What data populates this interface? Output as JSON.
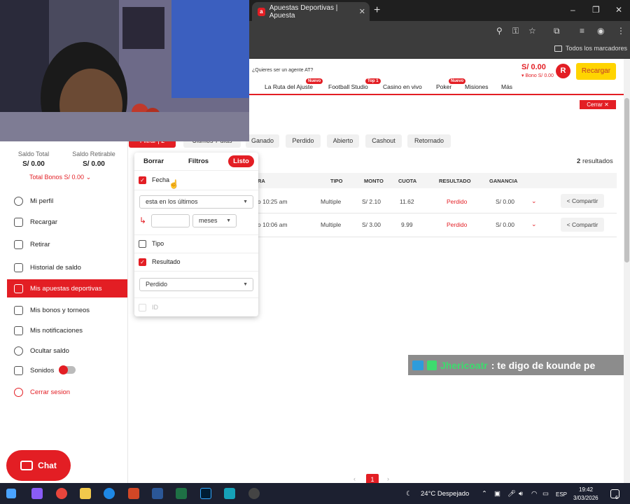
{
  "browser": {
    "tab_title": "Apuestas Deportivas | Apuesta",
    "tab_favicon": "a",
    "bookmarks_label": "Todos los marcadores"
  },
  "site": {
    "agent_link": "¿Quieres ser un agente AT?",
    "balance": "S/ 0.00",
    "bonus": "Bono S/ 0.00",
    "avatar_letter": "R",
    "recargar": "Recargar",
    "nav": [
      {
        "label": "La Ruta del Ajuste",
        "badge": "Nuevo"
      },
      {
        "label": "Football Studio",
        "badge": "Top 1"
      },
      {
        "label": "Casino en vivo",
        "badge": ""
      },
      {
        "label": "Poker",
        "badge": "Nuevo"
      },
      {
        "label": "Misiones",
        "badge": ""
      },
      {
        "label": "Más",
        "badge": ""
      }
    ],
    "cerrar": "Cerrar ✕"
  },
  "sidebar": {
    "saldo_total_label": "Saldo Total",
    "saldo_total": "S/ 0.00",
    "saldo_retirable_label": "Saldo Retirable",
    "saldo_retirable": "S/ 0.00",
    "total_bonos": "Total Bonos S/ 0.00",
    "menu": [
      {
        "label": "Mi perfil",
        "icon": "user-icon"
      },
      {
        "label": "Recargar",
        "icon": "refresh-icon"
      },
      {
        "label": "Retirar",
        "icon": "withdraw-icon"
      },
      {
        "label": "Historial de saldo",
        "icon": "history-icon"
      },
      {
        "label": "Mis apuestas deportivas",
        "icon": "ticket-icon",
        "active": true
      },
      {
        "label": "Mis bonos y torneos",
        "icon": "gift-icon"
      },
      {
        "label": "Mis notificaciones",
        "icon": "mail-icon"
      },
      {
        "label": "Ocultar saldo",
        "icon": "eye-off-icon"
      },
      {
        "label": "Sonidos",
        "icon": "speaker-icon"
      },
      {
        "label": "Cerrar sesion",
        "icon": "power-icon"
      }
    ],
    "chat": "Chat"
  },
  "filters": {
    "chip_filtrar": "Filtrar | 2",
    "chip_ultimos": "Últimos 7 días",
    "chips": [
      "Ganado",
      "Perdido",
      "Abierto",
      "Cashout",
      "Retornado"
    ],
    "results": "2",
    "results_label": "resultados"
  },
  "popup": {
    "borrar": "Borrar",
    "filtros": "Filtros",
    "listo": "Listo",
    "fecha": "Fecha",
    "fecha_select": "esta en los últimos",
    "unit_select": "meses",
    "tipo": "Tipo",
    "resultado": "Resultado",
    "resultado_select": "Perdido",
    "id": "ID"
  },
  "table": {
    "headers": [
      "RA",
      "TIPO",
      "MONTO",
      "CUOTA",
      "RESULTADO",
      "GANANCIA"
    ],
    "rows": [
      {
        "time": "o 10:25 am",
        "tipo": "Multiple",
        "monto": "S/ 2.10",
        "cuota": "11.62",
        "resultado": "Perdido",
        "ganancia": "S/ 0.00",
        "share": "Compartir"
      },
      {
        "time": "o 10:06 am",
        "tipo": "Multiple",
        "monto": "S/ 3.00",
        "cuota": "9.99",
        "resultado": "Perdido",
        "ganancia": "S/ 0.00",
        "share": "Compartir"
      }
    ]
  },
  "stream_chat": {
    "user": "Jhericoatr",
    "message": ": te digo de kounde pe"
  },
  "pagination": {
    "prev": "‹",
    "page": "1",
    "next": "›"
  },
  "taskbar": {
    "weather": "24°C Despejado",
    "lang": "ESP",
    "time": "19:42",
    "date": "3/03/2026",
    "notif_count": "6"
  },
  "colors": {
    "brand": "#e31e24",
    "accent_yellow": "#ffd400"
  }
}
